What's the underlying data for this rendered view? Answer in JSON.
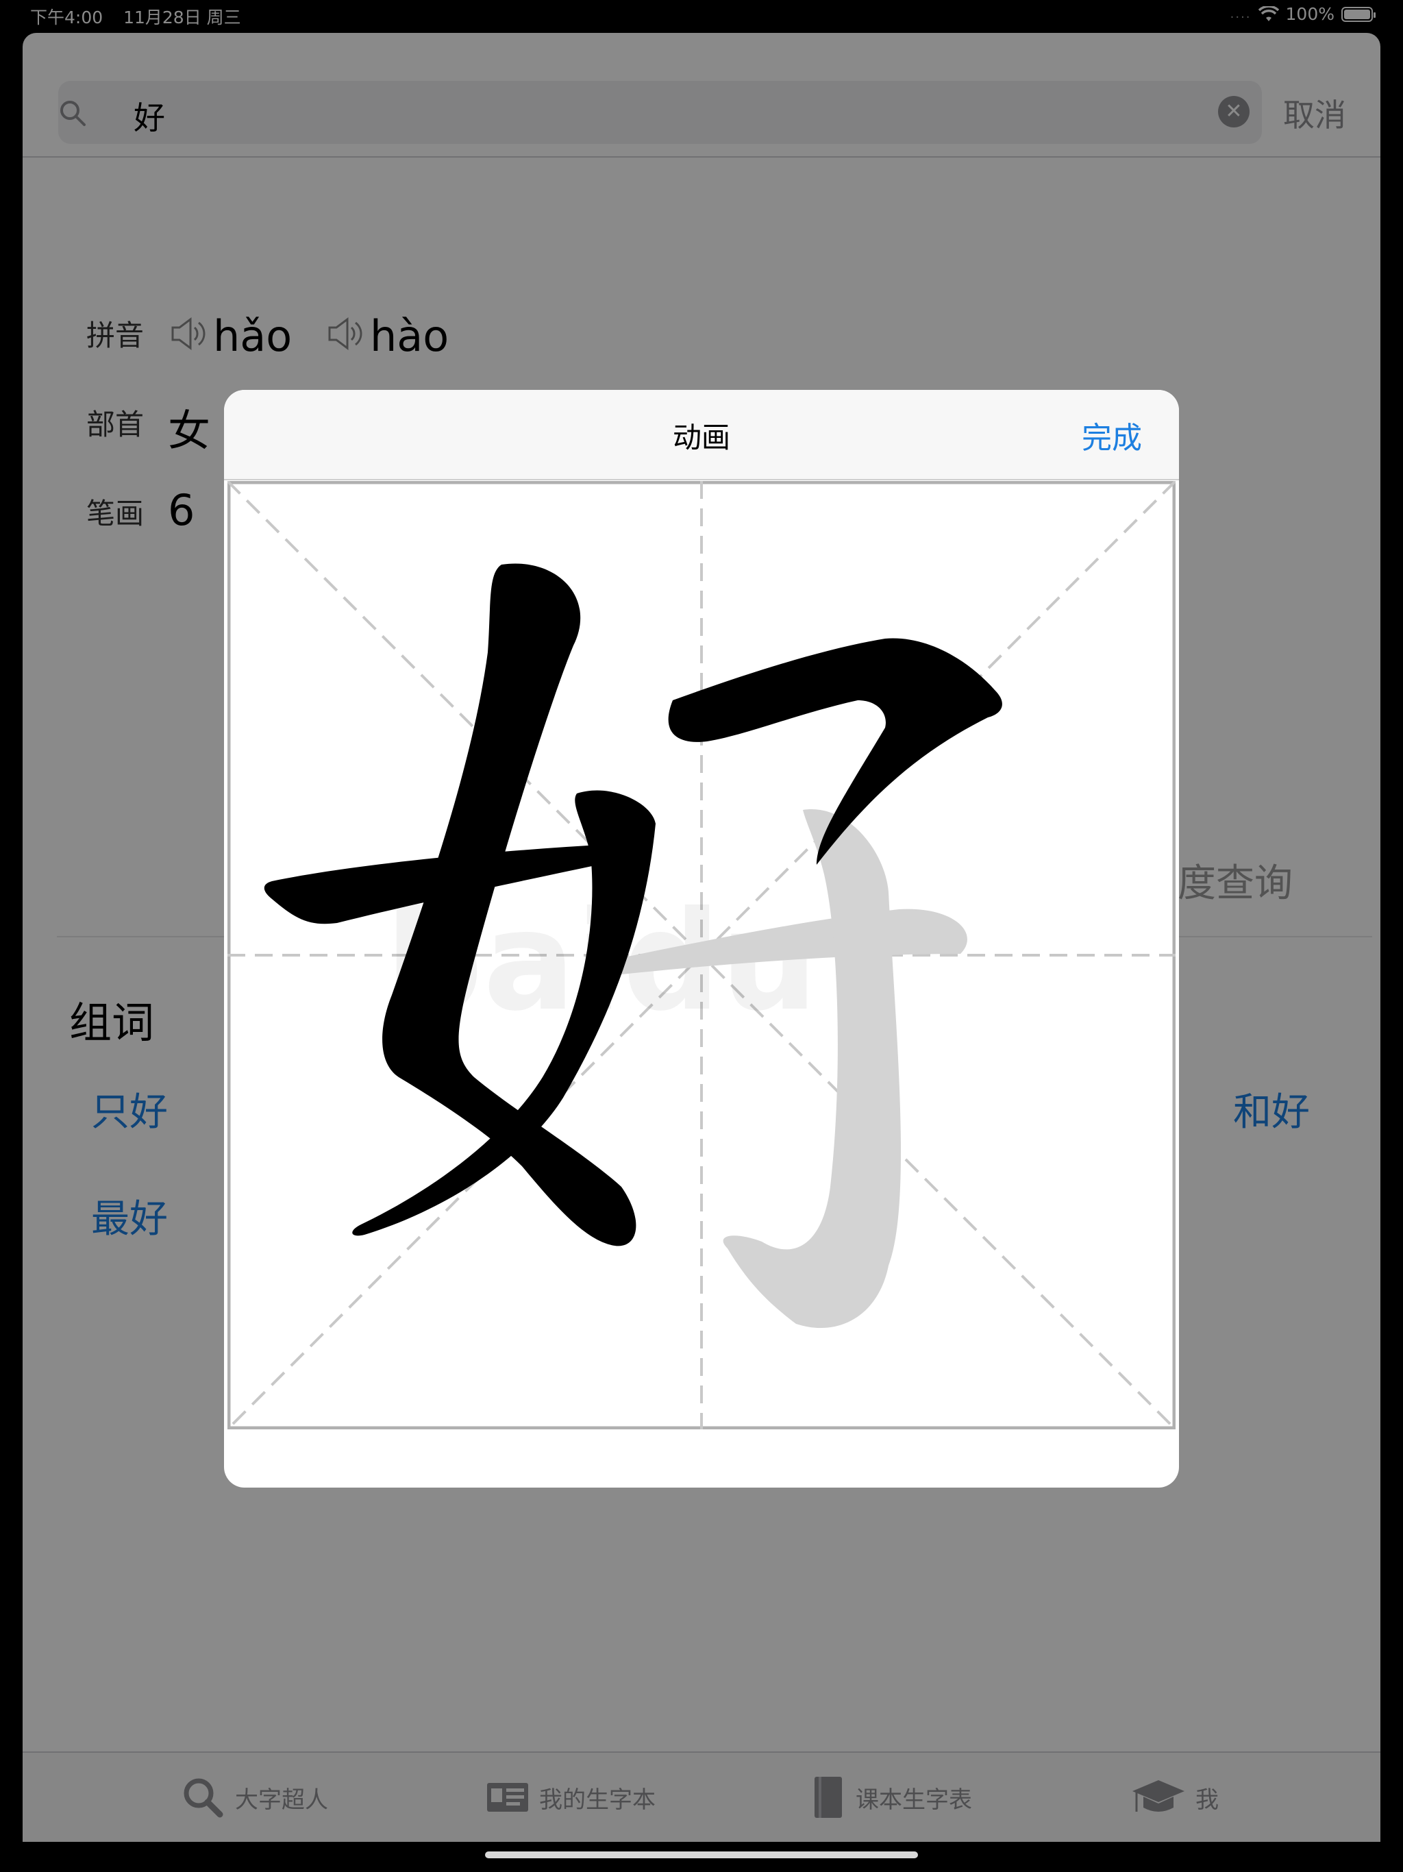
{
  "status_bar": {
    "time": "下午4:00",
    "date": "11月28日 周三",
    "signal": "....",
    "battery": "100%"
  },
  "search": {
    "query": "好",
    "clear_icon": "clear-icon",
    "cancel_label": "取消"
  },
  "info": {
    "pinyin_label": "拼音",
    "pinyin": [
      "hǎo",
      "hào"
    ],
    "radical_label": "部首",
    "radical": "女",
    "strokes_label": "笔画",
    "strokes": "6"
  },
  "baidu_query": "度查询",
  "words": {
    "title": "组词",
    "items": [
      "只好",
      "和好",
      "最好"
    ]
  },
  "tabs": [
    {
      "label": "大字超人",
      "icon": "search-icon"
    },
    {
      "label": "我的生字本",
      "icon": "id-card-icon"
    },
    {
      "label": "课本生字表",
      "icon": "book-icon"
    },
    {
      "label": "我",
      "icon": "graduation-cap-icon"
    }
  ],
  "modal": {
    "title": "动画",
    "done_label": "完成",
    "character": "好",
    "watermark": "baidu",
    "colors": {
      "drawn": "#000000",
      "pending": "#d3d3d3",
      "guide": "#c8c8c8"
    }
  }
}
